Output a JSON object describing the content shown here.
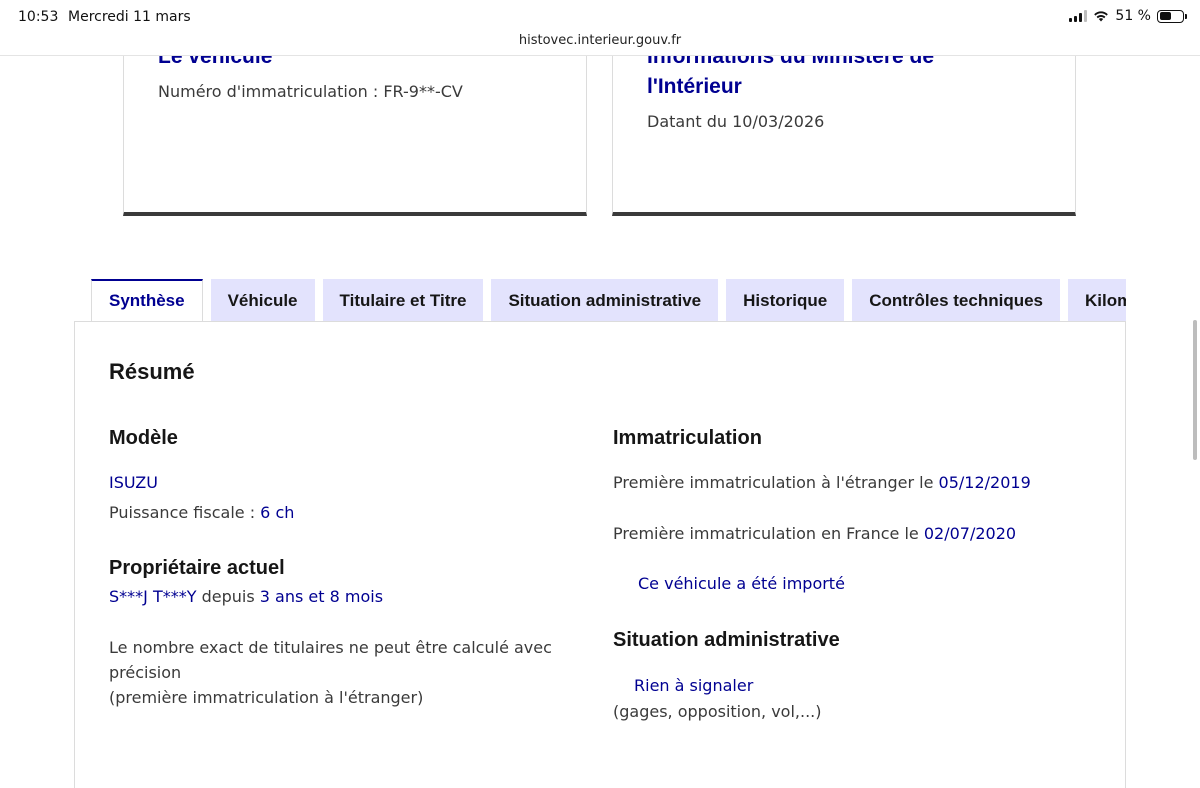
{
  "status_bar": {
    "time": "10:53",
    "date": "Mercredi 11 mars",
    "battery": "51 %",
    "battery_level": 0.51
  },
  "browser": {
    "url": "histovec.interieur.gouv.fr"
  },
  "cards": [
    {
      "title": "Le véhicule",
      "text": "Numéro d'immatriculation : FR-9**-CV"
    },
    {
      "title": "Informations du Ministère de l'Intérieur",
      "text": "Datant du 10/03/2026"
    }
  ],
  "tabs": [
    "Synthèse",
    "Véhicule",
    "Titulaire et Titre",
    "Situation administrative",
    "Historique",
    "Contrôles techniques",
    "Kilométrage"
  ],
  "summary": {
    "title": "Résumé",
    "model": {
      "heading": "Modèle",
      "brand": "ISUZU",
      "power_label": "Puissance fiscale : ",
      "power_value": "6 ch"
    },
    "owner": {
      "heading": "Propriétaire actuel",
      "name": "S***J T***Y",
      "since_label": " depuis ",
      "since_value": "3 ans et 8 mois",
      "note_line1": "Le nombre exact de titulaires ne peut être calculé avec",
      "note_line2": "précision",
      "note_line3": "(première immatriculation à l'étranger)"
    },
    "registration": {
      "heading": "Immatriculation",
      "foreign_label": "Première immatriculation à l'étranger le ",
      "foreign_date": "05/12/2019",
      "france_label": "Première immatriculation en France le ",
      "france_date": "02/07/2020",
      "imported_link": "Ce véhicule a été importé"
    },
    "admin": {
      "heading": "Situation administrative",
      "status_link": "Rien à signaler",
      "details": "(gages, opposition, vol,...)"
    }
  }
}
